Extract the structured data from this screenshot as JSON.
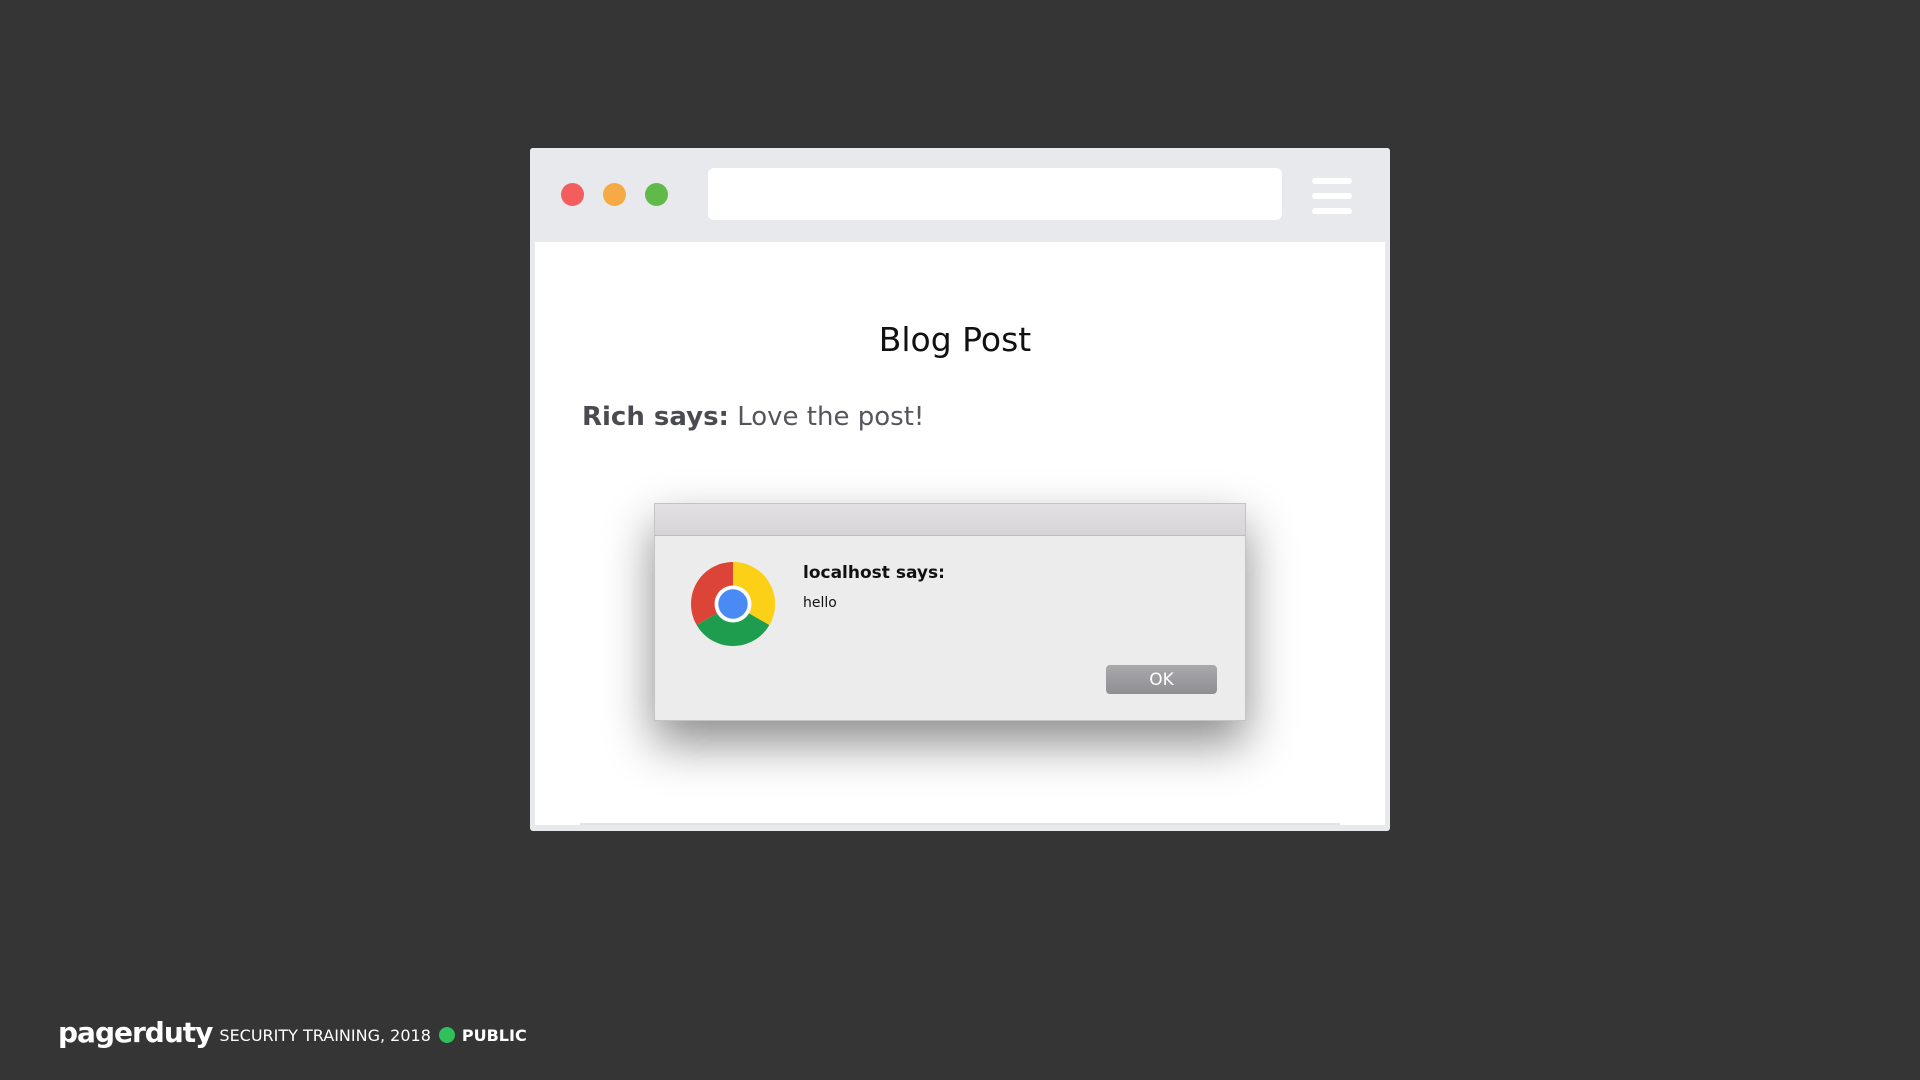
{
  "colors": {
    "background": "#353535",
    "traffic_red": "#f45d5d",
    "traffic_yellow": "#f6aa45",
    "traffic_green": "#5fba4a",
    "public_dot": "#2ec15c"
  },
  "browser": {
    "address_value": "",
    "menu_icon": "hamburger-menu-icon"
  },
  "page": {
    "title": "Blog Post",
    "comment": {
      "author": "Rich says:",
      "text": " Love the post!"
    }
  },
  "dialog": {
    "icon": "chrome-logo-icon",
    "heading": "localhost says:",
    "message": "hello",
    "ok_label": "OK"
  },
  "footer": {
    "brand": "pagerduty",
    "text": "SECURITY TRAINING, 2018",
    "status_label": "PUBLIC"
  }
}
